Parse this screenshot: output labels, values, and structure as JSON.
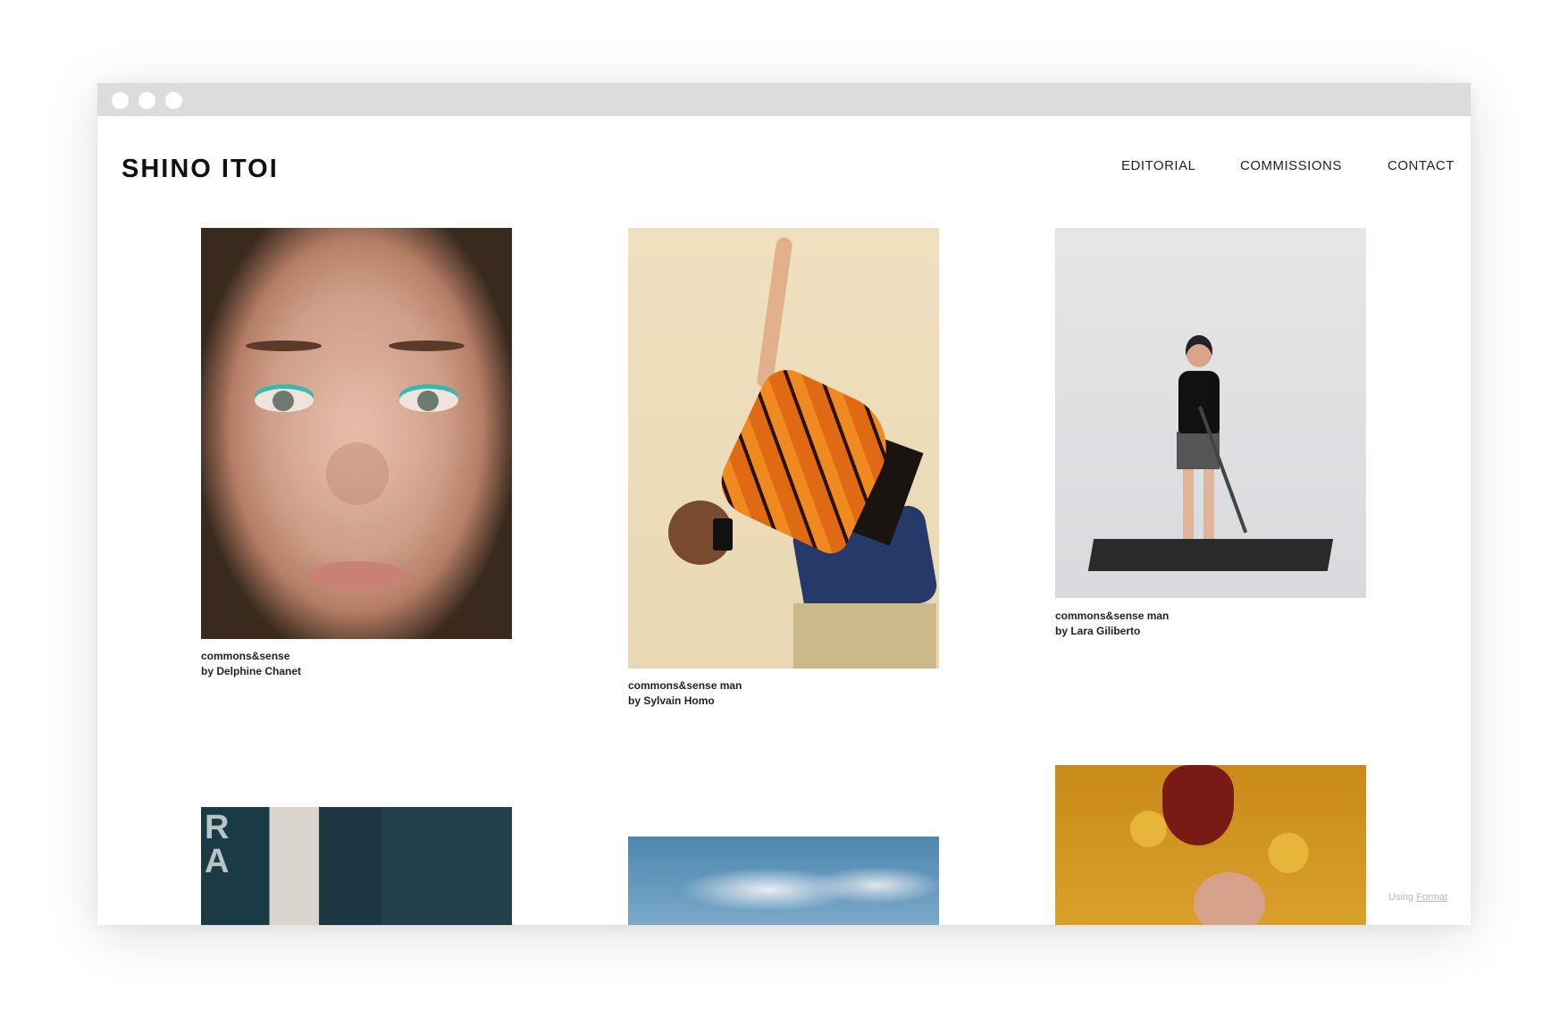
{
  "site": {
    "title": "SHINO ITOI"
  },
  "nav": {
    "items": [
      {
        "label": "EDITORIAL"
      },
      {
        "label": "COMMISSIONS"
      },
      {
        "label": "CONTACT"
      }
    ]
  },
  "gallery": {
    "items": [
      {
        "title": "commons&sense",
        "credit": "by Delphine Chanet"
      },
      {
        "title": "commons&sense man",
        "credit": "by Sylvain Homo"
      },
      {
        "title": "commons&sense man",
        "credit": "by Lara Giliberto"
      },
      {
        "title": "",
        "credit": ""
      },
      {
        "title": "",
        "credit": ""
      },
      {
        "title": "",
        "credit": ""
      }
    ]
  },
  "footer": {
    "prefix": "Using",
    "link": "Format"
  },
  "colors": {
    "titlebar": "#dcdcdc",
    "text": "#111111",
    "footer": "#b8b8b8"
  }
}
